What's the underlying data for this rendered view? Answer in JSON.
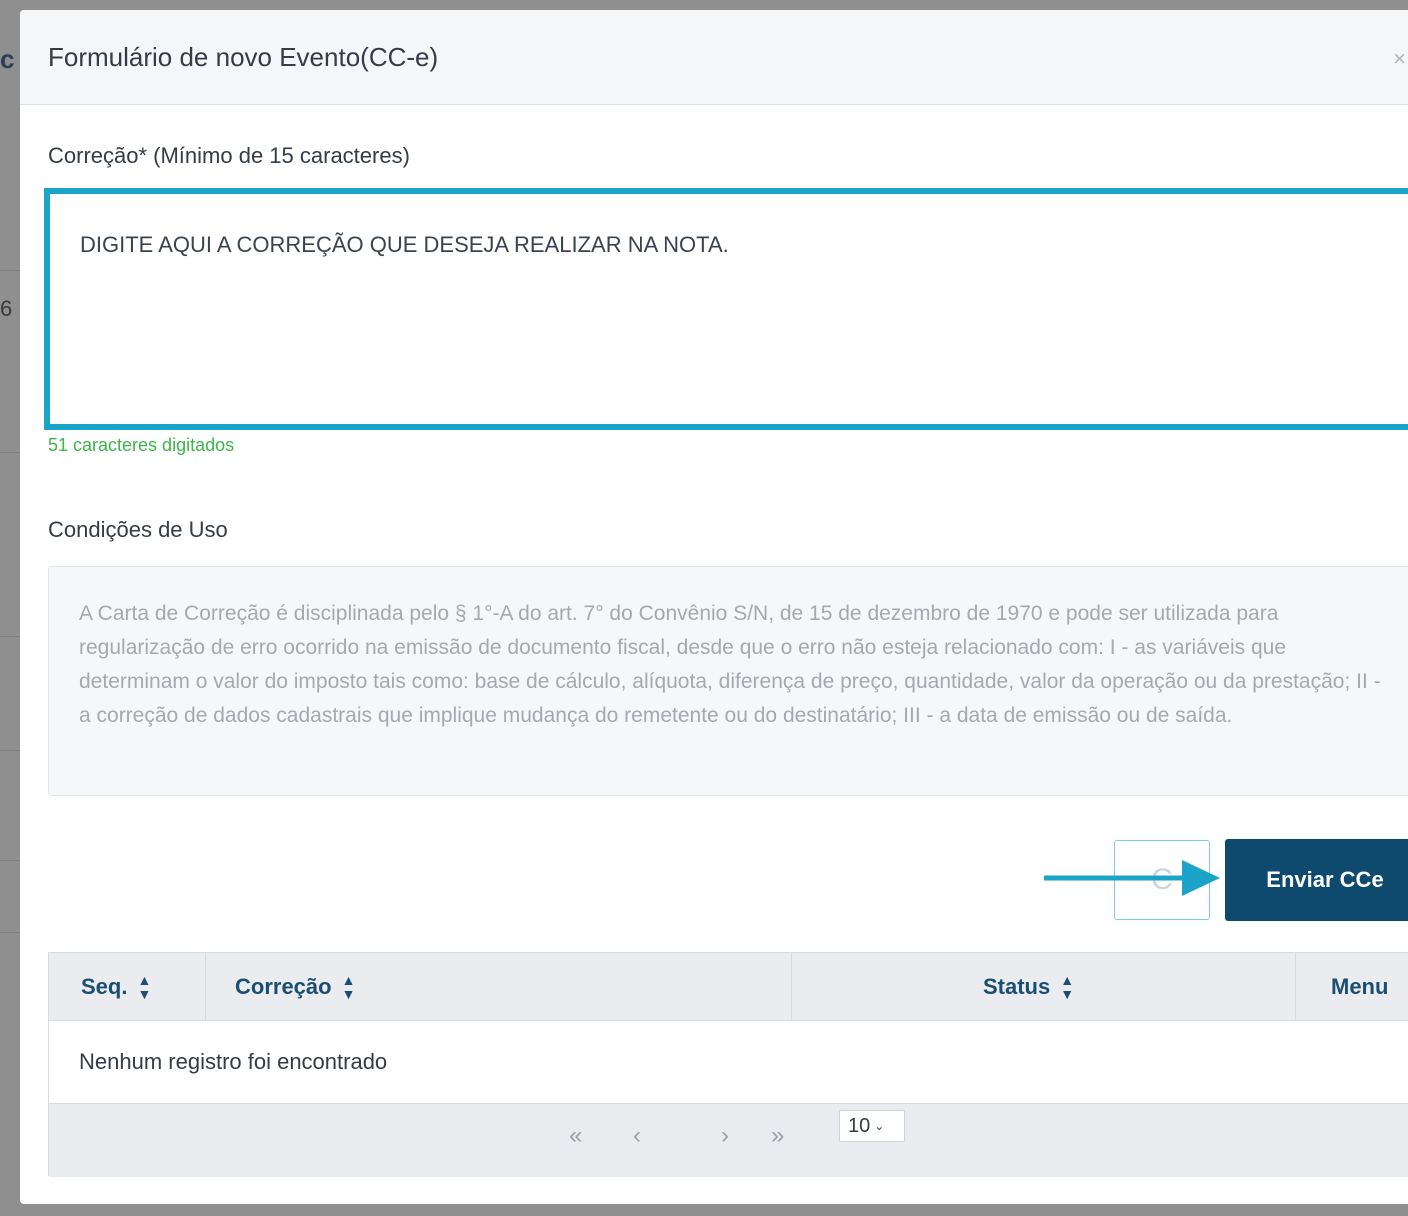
{
  "backdrop": {
    "letters": [
      "c",
      "6"
    ]
  },
  "modal": {
    "title": "Formulário de novo Evento(CC-e)",
    "close_icon": "close-icon"
  },
  "correction": {
    "label": "Correção* (Mínimo de 15 caracteres)",
    "value": "DIGITE AQUI A CORREÇÃO QUE DESEJA REALIZAR NA NOTA.",
    "counter": "51 caracteres digitados"
  },
  "terms": {
    "label": "Condições de Uso",
    "text": "A Carta de Correção é disciplinada pelo § 1°-A do art. 7° do Convênio S/N, de 15 de dezembro de 1970 e pode ser utilizada para regularização de erro ocorrido na emissão de documento fiscal, desde que o erro não esteja relacionado com: I - as variáveis que determinam o valor do imposto tais como: base de cálculo, alíquota, diferença de preço, quantidade, valor da operação ou da prestação; II - a correção de dados cadastrais que implique mudança do remetente ou do destinatário; III - a data de emissão ou de saída."
  },
  "actions": {
    "secondary_label": "C",
    "submit_label": "Enviar CCe",
    "accent": "#1aa5c8",
    "primary_color": "#0d4a6e"
  },
  "table": {
    "columns": [
      {
        "label": "Seq.",
        "sortable": true
      },
      {
        "label": "Correção",
        "sortable": true
      },
      {
        "label": "Status",
        "sortable": true
      },
      {
        "label": "Menu",
        "sortable": false
      }
    ],
    "empty_message": "Nenhum registro foi encontrado",
    "pager": {
      "first": "«",
      "prev": "‹",
      "next": "›",
      "last": "»",
      "page_size": "10"
    }
  }
}
